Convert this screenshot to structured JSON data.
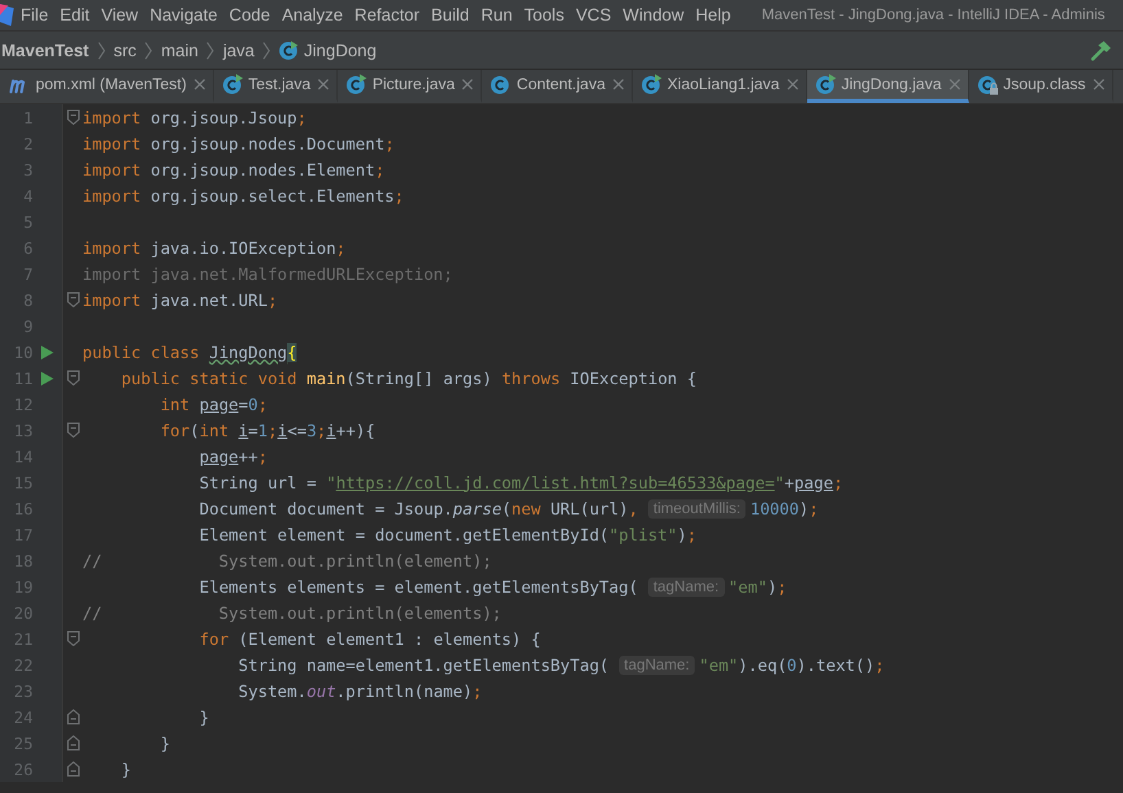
{
  "menu_bar": {
    "items": [
      "File",
      "Edit",
      "View",
      "Navigate",
      "Code",
      "Analyze",
      "Refactor",
      "Build",
      "Run",
      "Tools",
      "VCS",
      "Window",
      "Help"
    ],
    "title": "MavenTest - JingDong.java - IntelliJ IDEA - Adminis"
  },
  "breadcrumbs": [
    {
      "label": "MavenTest",
      "kind": "project"
    },
    {
      "label": "src",
      "kind": "folder"
    },
    {
      "label": "main",
      "kind": "folder"
    },
    {
      "label": "java",
      "kind": "folder"
    },
    {
      "label": "JingDong",
      "kind": "class"
    }
  ],
  "tabs": [
    {
      "label": "pom.xml (MavenTest)",
      "kind": "maven",
      "selected": false
    },
    {
      "label": "Test.java",
      "kind": "runnable",
      "selected": false
    },
    {
      "label": "Picture.java",
      "kind": "runnable",
      "selected": false
    },
    {
      "label": "Content.java",
      "kind": "class",
      "selected": false
    },
    {
      "label": "XiaoLiang1.java",
      "kind": "runnable",
      "selected": false
    },
    {
      "label": "JingDong.java",
      "kind": "runnable",
      "selected": true
    },
    {
      "label": "Jsoup.class",
      "kind": "locked",
      "selected": false
    }
  ],
  "editor": {
    "lines": [
      {
        "number": "1",
        "run": false,
        "kind": "fold-start",
        "tokens": [
          {
            "text": "import",
            "kind": "keyword"
          },
          {
            "text": " org.jsoup.Jsoup",
            "kind": "plain"
          },
          {
            "text": ";",
            "kind": "keyword"
          }
        ]
      },
      {
        "number": "2",
        "run": false,
        "kind": "plain",
        "tokens": [
          {
            "text": "import",
            "kind": "keyword"
          },
          {
            "text": " org.jsoup.nodes.Document",
            "kind": "plain"
          },
          {
            "text": ";",
            "kind": "keyword"
          }
        ]
      },
      {
        "number": "3",
        "run": false,
        "kind": "plain",
        "tokens": [
          {
            "text": "import",
            "kind": "keyword"
          },
          {
            "text": " org.jsoup.nodes.Element",
            "kind": "plain"
          },
          {
            "text": ";",
            "kind": "keyword"
          }
        ]
      },
      {
        "number": "4",
        "run": false,
        "kind": "plain",
        "tokens": [
          {
            "text": "import",
            "kind": "keyword"
          },
          {
            "text": " org.jsoup.select.Elements",
            "kind": "plain"
          },
          {
            "text": ";",
            "kind": "keyword"
          }
        ]
      },
      {
        "number": "5",
        "run": false,
        "kind": "plain"
      },
      {
        "number": "6",
        "run": false,
        "kind": "plain",
        "tokens": [
          {
            "text": "import",
            "kind": "keyword"
          },
          {
            "text": " java.io.IOException",
            "kind": "plain"
          },
          {
            "text": ";",
            "kind": "keyword"
          }
        ]
      },
      {
        "number": "7",
        "run": false,
        "kind": "plain",
        "tokens": [
          {
            "text": "import java.net.MalformedURLException;",
            "kind": "unused"
          }
        ]
      },
      {
        "number": "8",
        "run": false,
        "kind": "fold-start",
        "tokens": [
          {
            "text": "import",
            "kind": "keyword"
          },
          {
            "text": " java.net.URL",
            "kind": "plain"
          },
          {
            "text": ";",
            "kind": "keyword"
          }
        ]
      },
      {
        "number": "9",
        "run": false,
        "kind": "plain"
      },
      {
        "number": "10",
        "run": true,
        "kind": "plain",
        "tokens": [
          {
            "text": "public class ",
            "kind": "keyword"
          },
          {
            "text": "JingDong",
            "kind": "typo"
          },
          {
            "text": "{",
            "kind": "brace"
          }
        ]
      },
      {
        "number": "11",
        "run": true,
        "kind": "fold-start",
        "tokens": [
          {
            "text": "    public static void ",
            "kind": "keyword"
          },
          {
            "text": "main",
            "kind": "method"
          },
          {
            "text": "(String[] args) ",
            "kind": "plain"
          },
          {
            "text": "throws ",
            "kind": "keyword"
          },
          {
            "text": "IOException {",
            "kind": "plain"
          }
        ]
      },
      {
        "number": "12",
        "run": false,
        "kind": "plain",
        "tokens": [
          {
            "text": "        int ",
            "kind": "keyword"
          },
          {
            "text": "page",
            "kind": "var"
          },
          {
            "text": "=",
            "kind": "plain"
          },
          {
            "text": "0",
            "kind": "number"
          },
          {
            "text": ";",
            "kind": "keyword"
          }
        ]
      },
      {
        "number": "13",
        "run": false,
        "kind": "fold-start",
        "tokens": [
          {
            "text": "        for",
            "kind": "keyword"
          },
          {
            "text": "(",
            "kind": "plain"
          },
          {
            "text": "int ",
            "kind": "keyword"
          },
          {
            "text": "i",
            "kind": "var"
          },
          {
            "text": "=",
            "kind": "plain"
          },
          {
            "text": "1",
            "kind": "number"
          },
          {
            "text": ";",
            "kind": "keyword"
          },
          {
            "text": "i",
            "kind": "var"
          },
          {
            "text": "<=",
            "kind": "plain"
          },
          {
            "text": "3",
            "kind": "number"
          },
          {
            "text": ";",
            "kind": "keyword"
          },
          {
            "text": "i",
            "kind": "var"
          },
          {
            "text": "++){",
            "kind": "plain"
          }
        ]
      },
      {
        "number": "14",
        "run": false,
        "kind": "plain",
        "tokens": [
          {
            "text": "            page",
            "kind": "var"
          },
          {
            "text": "++",
            "kind": "plain"
          },
          {
            "text": ";",
            "kind": "keyword"
          }
        ]
      },
      {
        "number": "15",
        "run": false,
        "kind": "plain",
        "tokens": [
          {
            "text": "            String url = ",
            "kind": "plain"
          },
          {
            "text": "\"",
            "kind": "string"
          },
          {
            "text": "https://coll.jd.com/list.html?sub=46533&page=",
            "kind": "url"
          },
          {
            "text": "\"",
            "kind": "string"
          },
          {
            "text": "+",
            "kind": "plain"
          },
          {
            "text": "page",
            "kind": "var"
          },
          {
            "text": ";",
            "kind": "keyword"
          }
        ]
      },
      {
        "number": "16",
        "run": false,
        "kind": "plain",
        "tokens": [
          {
            "text": "            Document document = Jsoup.",
            "kind": "plain"
          },
          {
            "text": "parse",
            "kind": "italic"
          },
          {
            "text": "(",
            "kind": "plain"
          },
          {
            "text": "new ",
            "kind": "keyword"
          },
          {
            "text": "URL(url)",
            "kind": "plain"
          },
          {
            "text": ",",
            "kind": "keyword"
          },
          {
            "text": "timeoutMillis:",
            "kind": "hint"
          },
          {
            "text": "10000",
            "kind": "number"
          },
          {
            "text": ")",
            "kind": "plain"
          },
          {
            "text": ";",
            "kind": "keyword"
          }
        ]
      },
      {
        "number": "17",
        "run": false,
        "kind": "plain",
        "tokens": [
          {
            "text": "            Element element = document.getElementById(",
            "kind": "plain"
          },
          {
            "text": "\"plist\"",
            "kind": "string"
          },
          {
            "text": ")",
            "kind": "plain"
          },
          {
            "text": ";",
            "kind": "keyword"
          }
        ]
      },
      {
        "number": "18",
        "run": false,
        "kind": "plain",
        "tokens": [
          {
            "text": "//            System.out.println(element);",
            "kind": "comment"
          }
        ]
      },
      {
        "number": "19",
        "run": false,
        "kind": "plain",
        "tokens": [
          {
            "text": "            Elements elements = element.getElementsByTag(",
            "kind": "plain"
          },
          {
            "text": "tagName:",
            "kind": "hint"
          },
          {
            "text": "\"em\"",
            "kind": "string"
          },
          {
            "text": ")",
            "kind": "plain"
          },
          {
            "text": ";",
            "kind": "keyword"
          }
        ]
      },
      {
        "number": "20",
        "run": false,
        "kind": "plain",
        "tokens": [
          {
            "text": "//            System.out.println(elements);",
            "kind": "comment"
          }
        ]
      },
      {
        "number": "21",
        "run": false,
        "kind": "fold-start",
        "tokens": [
          {
            "text": "            for ",
            "kind": "keyword"
          },
          {
            "text": "(Element element1 : elements) {",
            "kind": "plain"
          }
        ]
      },
      {
        "number": "22",
        "run": false,
        "kind": "plain",
        "tokens": [
          {
            "text": "                String name=element1.getElementsByTag(",
            "kind": "plain"
          },
          {
            "text": "tagName:",
            "kind": "hint"
          },
          {
            "text": "\"em\"",
            "kind": "string"
          },
          {
            "text": ").eq(",
            "kind": "plain"
          },
          {
            "text": "0",
            "kind": "number"
          },
          {
            "text": ").text()",
            "kind": "plain"
          },
          {
            "text": ";",
            "kind": "keyword"
          }
        ]
      },
      {
        "number": "23",
        "run": false,
        "kind": "plain",
        "tokens": [
          {
            "text": "                System.",
            "kind": "plain"
          },
          {
            "text": "out",
            "kind": "field"
          },
          {
            "text": ".println(name)",
            "kind": "plain"
          },
          {
            "text": ";",
            "kind": "keyword"
          }
        ]
      },
      {
        "number": "24",
        "run": false,
        "kind": "fold-end",
        "tokens": [
          {
            "text": "            }",
            "kind": "plain"
          }
        ]
      },
      {
        "number": "25",
        "run": false,
        "kind": "fold-end",
        "tokens": [
          {
            "text": "        }",
            "kind": "plain"
          }
        ]
      },
      {
        "number": "26",
        "run": false,
        "kind": "fold-end",
        "tokens": [
          {
            "text": "    }",
            "kind": "plain"
          }
        ]
      }
    ]
  }
}
